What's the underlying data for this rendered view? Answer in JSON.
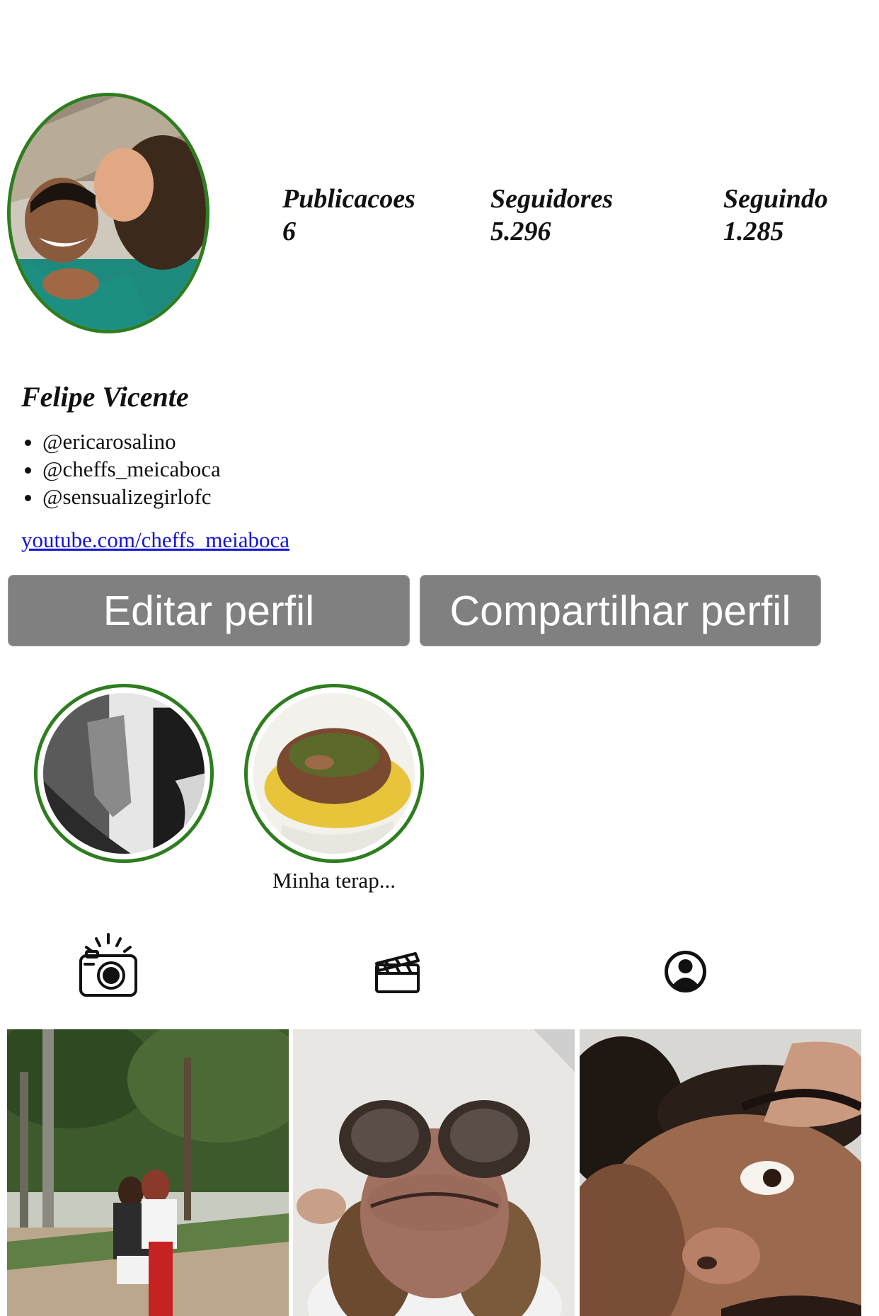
{
  "profile": {
    "avatar_alt": "Foto de perfil",
    "ring_color": "#2e7d1f",
    "name": "Felipe Vicente",
    "stats": [
      {
        "label": "Publicacoes",
        "value": "6"
      },
      {
        "label": "Seguidores",
        "value": "5.296"
      },
      {
        "label": "Seguindo",
        "value": "1.285"
      }
    ],
    "mentions": [
      "@ericarosalino",
      "@cheffs_meicaboca",
      "@sensualizegirlofc"
    ],
    "link": "youtube.com/cheffs_meiaboca"
  },
  "buttons": {
    "edit": "Editar perfil",
    "share": "Compartilhar perfil",
    "background": "#808080"
  },
  "highlights": [
    {
      "label": "",
      "icon": "highlight-photo"
    },
    {
      "label": "Minha terap...",
      "icon": "highlight-photo"
    }
  ],
  "tabs": [
    {
      "icon": "camera-icon"
    },
    {
      "icon": "clapperboard-icon"
    },
    {
      "icon": "user-circle-icon"
    }
  ],
  "link_color": "#1414d9"
}
